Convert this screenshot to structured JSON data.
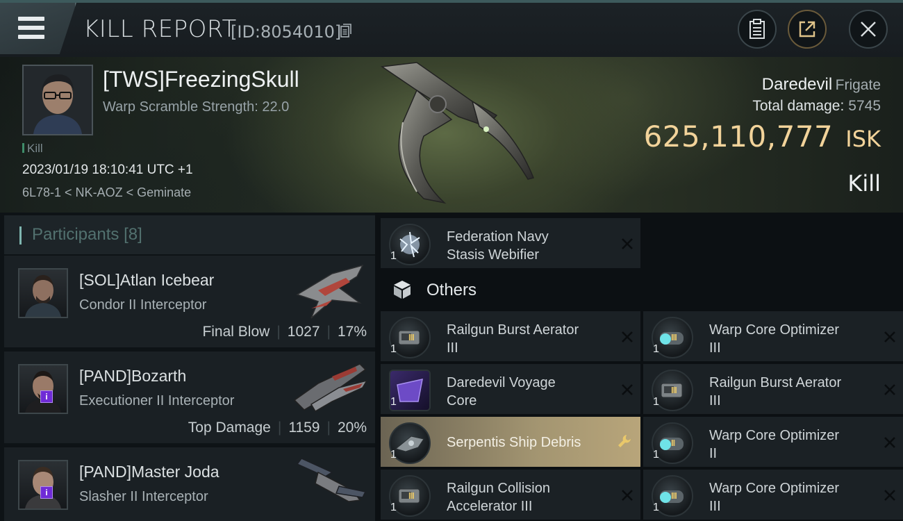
{
  "header": {
    "title": "KILL REPORT",
    "report_id": "[ID:8054010]"
  },
  "victim": {
    "name": "[TWS]FreezingSkull",
    "stat": "Warp Scramble Strength: 22.0",
    "kill_tag": "Kill",
    "datetime": "2023/01/19 18:10:41 UTC +1",
    "location": "6L78-1 < NK-AOZ < Geminate"
  },
  "ship": {
    "name": "Daredevil",
    "class": "Frigate",
    "total_damage_label": "Total damage:",
    "total_damage": "5745",
    "isk_value": "625,110,777",
    "isk_unit": "ISK",
    "status": "Kill"
  },
  "participants": {
    "title": "Participants",
    "count": "[8]",
    "rows": [
      {
        "name": "[SOL]Atlan Icebear",
        "ship": "Condor II Interceptor",
        "stat_label": "Final Blow",
        "damage": "1027",
        "percent": "17%"
      },
      {
        "name": "[PAND]Bozarth",
        "ship": "Executioner II Interceptor",
        "stat_label": "Top Damage",
        "damage": "1159",
        "percent": "20%"
      },
      {
        "name": "[PAND]Master Joda",
        "ship": "Slasher II Interceptor",
        "stat_label": "",
        "damage": "",
        "percent": ""
      }
    ]
  },
  "items": {
    "top": {
      "name_line1": "Federation Navy",
      "name_line2": "Stasis Webifier",
      "qty": "1"
    },
    "others_label": "Others",
    "left": [
      {
        "name_line1": "Railgun Burst Aerator",
        "name_line2": "III",
        "qty": "1",
        "tier": "III"
      },
      {
        "name_line1": "Daredevil Voyage",
        "name_line2": "Core",
        "qty": "1"
      },
      {
        "name_line1": "Serpentis Ship Debris",
        "name_line2": "",
        "qty": "1"
      },
      {
        "name_line1": "Railgun Collision",
        "name_line2": "Accelerator III",
        "qty": "1",
        "tier": "III"
      }
    ],
    "right": [
      {
        "name_line1": "Warp Core Optimizer",
        "name_line2": "III",
        "qty": "1",
        "tier": "III"
      },
      {
        "name_line1": "Railgun Burst Aerator",
        "name_line2": "III",
        "qty": "1",
        "tier": "III"
      },
      {
        "name_line1": "Warp Core Optimizer",
        "name_line2": "II",
        "qty": "1",
        "tier": "II"
      },
      {
        "name_line1": "Warp Core Optimizer",
        "name_line2": "III",
        "qty": "1",
        "tier": "III"
      }
    ]
  },
  "colors": {
    "accent_gold": "#f2d39a",
    "highlight_row": "#b8a57a",
    "participants_title": "#52716f",
    "badge_purple": "#6f2bd6"
  },
  "icons": [
    "menu-icon",
    "copy-icon",
    "clipboard-icon",
    "share-icon",
    "close-icon",
    "cube-icon",
    "remove-icon",
    "wrench-icon"
  ]
}
